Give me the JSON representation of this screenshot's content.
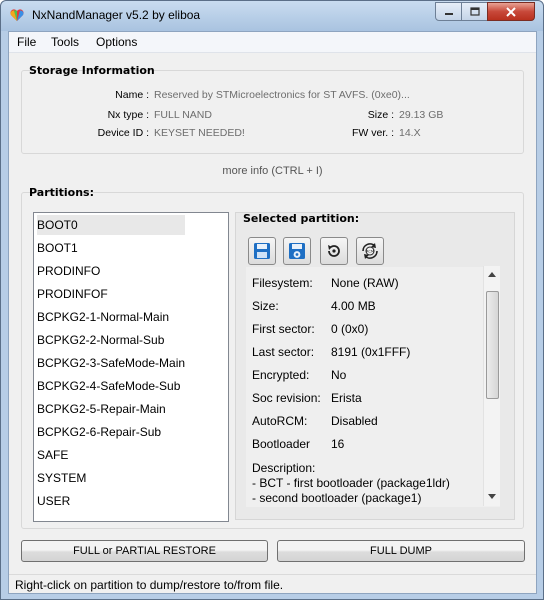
{
  "window": {
    "title": "NxNandManager v5.2 by eliboa",
    "app_icon": "heart-icon"
  },
  "menu": [
    "File",
    "Tools",
    "Options"
  ],
  "storage": {
    "title": "Storage Information",
    "name_label": "Name :",
    "name_value": "Reserved by STMicroelectronics for ST AVFS. (0xe0)...",
    "nxtype_label": "Nx type :",
    "nxtype_value": "FULL NAND",
    "size_label": "Size :",
    "size_value": "29.13 GB",
    "deviceid_label": "Device ID :",
    "deviceid_value": "KEYSET NEEDED!",
    "fwver_label": "FW ver. :",
    "fwver_value": "14.X",
    "more_info": "more info (CTRL + I)"
  },
  "partitions": {
    "title": "Partitions:",
    "items": [
      "BOOT0",
      "BOOT1",
      "PRODINFO",
      "PRODINFOF",
      "BCPKG2-1-Normal-Main",
      "BCPKG2-2-Normal-Sub",
      "BCPKG2-3-SafeMode-Main",
      "BCPKG2-4-SafeMode-Sub",
      "BCPKG2-5-Repair-Main",
      "BCPKG2-6-Repair-Sub",
      "SAFE",
      "SYSTEM",
      "USER"
    ],
    "selected_index": 0
  },
  "selected": {
    "title": "Selected partition:",
    "tools": [
      "save-icon",
      "save-settings-icon",
      "restore-icon",
      "autorcm-icon"
    ],
    "rows": [
      {
        "label": "Filesystem:",
        "value": "None (RAW)"
      },
      {
        "label": "Size:",
        "value": "4.00 MB"
      },
      {
        "label": "First sector:",
        "value": "0 (0x0)"
      },
      {
        "label": "Last sector:",
        "value": "8191 (0x1FFF)"
      },
      {
        "label": "Encrypted:",
        "value": "No"
      },
      {
        "label": "Soc revision:",
        "value": "Erista"
      },
      {
        "label": "AutoRCM:",
        "value": "Disabled"
      },
      {
        "label": "Bootloader",
        "value": "16"
      }
    ],
    "description_label": "Description:",
    "description_lines": [
      "- BCT - first bootloader (package1ldr)",
      "- second bootloader (package1)"
    ]
  },
  "buttons": {
    "restore": "FULL or PARTIAL RESTORE",
    "dump": "FULL DUMP"
  },
  "status": "Right-click on partition to dump/restore to/from file.",
  "colors": {
    "titlebar": "#b7cde6",
    "close_button": "#c8493a",
    "selection": "#e8e8e8",
    "value_gray": "#6d6d6d"
  }
}
